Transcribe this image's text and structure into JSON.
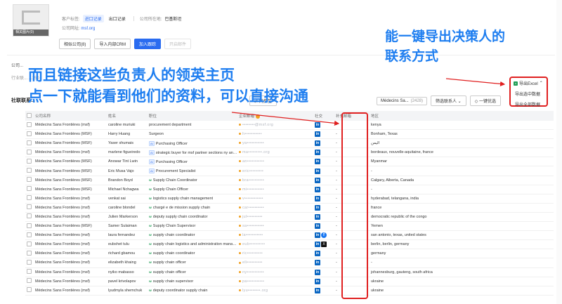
{
  "company": {
    "logo_caption": "相关图片(0)",
    "tag_label": "客户标签:",
    "tag_active": "进口记录",
    "tag_other": "出口记录",
    "country_label": "公司所在地:",
    "country_value": "巴基斯坦",
    "website_label": "公司网址:",
    "website_value": "msf.org"
  },
  "buttons": {
    "similar": "相似公司(8)",
    "import_crm": "导入内部CRM",
    "add_track": "加入跟踪",
    "open_email": "开启邮件"
  },
  "sub_label": "公司...",
  "tabs_hint": "行业联...                  ...150",
  "section_title": "社联联系...",
  "annotations": {
    "top_right_line1": "能一键导出决策人的",
    "top_right_line2": "联系方式",
    "left_line1": "而且链接这些负责人的领英主页",
    "left_line2": "点一下就能看到他们的资料，可以直接沟通"
  },
  "toolbar": {
    "sync_label": "同步至",
    "company_select": "Médecins Sa...",
    "company_count": "(2428)",
    "filter_contact": "筛选联系人",
    "one_key": "一键优选"
  },
  "export": {
    "head": "导出Excel",
    "item1": "导出选中数据",
    "item2": "导出全部数据"
  },
  "table": {
    "headers": [
      "公司名称",
      "姓名",
      "职位",
      "企业邮箱",
      "社交",
      "补充邮箱",
      "地区"
    ],
    "rows": [
      {
        "org": "Médecins Sans Frontières (msf)",
        "name": "caroline muriuki",
        "tag": "",
        "title": "procurement department",
        "email": "••••••••@msf.org",
        "social": [
          "in"
        ],
        "phone": "-",
        "region": "kenya"
      },
      {
        "org": "Médecins Sans Frontières (MSF)",
        "name": "Harry Huang",
        "tag": "",
        "title": "Surgeon",
        "email": "h•••••••••••",
        "social": [
          "in"
        ],
        "phone": "-",
        "region": "Bonham, Texas"
      },
      {
        "org": "Médecins Sans Frontières (MSF)",
        "name": "Yaser shumais",
        "tag": "ai",
        "title": "Purchasing Officer",
        "email": "ya•••••••••••",
        "social": [
          "in"
        ],
        "phone": "-",
        "region": "اليمن"
      },
      {
        "org": "Médecins Sans Frontières (msf)",
        "name": "marlene figueiredo",
        "tag": "ai",
        "title": "strategic buyer for msf partner sections ny and toronto",
        "email": "ma•••••••••.org",
        "social": [
          "in"
        ],
        "phone": "-",
        "region": "bordeaux, nouvelle-aquitaine, france"
      },
      {
        "org": "Médecins Sans Frontières (MSF)",
        "name": "Anowar Tint Lwin",
        "tag": "ai",
        "title": "Purchasing Officer",
        "email": "an•••••••••••",
        "social": [
          "in"
        ],
        "phone": "-",
        "region": "Myanmar"
      },
      {
        "org": "Médecins Sans Frontières (MSF)",
        "name": "Eric Musa Vajo",
        "tag": "ai",
        "title": "Procurement Specialist",
        "email": "eric•••••••••",
        "social": [
          "in"
        ],
        "phone": "-",
        "region": "-"
      },
      {
        "org": "Médecins Sans Frontières (MSF)",
        "name": "Brandon Boyd",
        "tag": "w",
        "title": "Supply Chain Coordinator",
        "email": "bra••••••••••",
        "social": [
          "in"
        ],
        "phone": "-",
        "region": "Calgary, Alberta, Canada"
      },
      {
        "org": "Médecins Sans Frontières (MSF)",
        "name": "Michael Nchagwa",
        "tag": "w",
        "title": "Supply Chain Officer",
        "email": "mi•••••••••••",
        "social": [
          "in"
        ],
        "phone": "-",
        "region": "-"
      },
      {
        "org": "Médecins Sans Frontières (msf)",
        "name": "venkat sai",
        "tag": "w",
        "title": "logistics supply chain management",
        "email": "v••••••••••••",
        "social": [
          "in"
        ],
        "phone": "-",
        "region": "hyderabad, telangana, india"
      },
      {
        "org": "Médecins Sans Frontières (msf)",
        "name": "caroline blondel",
        "tag": "w",
        "title": "chargé e de mission supply chain",
        "email": "car••••••••••",
        "social": [
          "in"
        ],
        "phone": "-",
        "region": "france"
      },
      {
        "org": "Médecins Sans Frontières (msf)",
        "name": "Julien Markerson",
        "tag": "w",
        "title": "deputy supply chain coordinator",
        "email": "jul••••••••••",
        "social": [
          "in"
        ],
        "phone": "-",
        "region": "democratic republic of the congo"
      },
      {
        "org": "Médecins Sans Frontières (MSF)",
        "name": "Samer Sulaiman",
        "tag": "w",
        "title": "Supply Chain Supervisor",
        "email": "sa•••••••••••",
        "social": [
          "in"
        ],
        "phone": "-",
        "region": "Yemen"
      },
      {
        "org": "Médecins Sans Frontières (msf)",
        "name": "laura fernandez",
        "tag": "w",
        "title": "supply chain coordinator",
        "email": "la•••••••••••",
        "social": [
          "in",
          "fb"
        ],
        "phone": "-",
        "region": "san antonio, texas, united states"
      },
      {
        "org": "Médecins Sans Frontières (msf)",
        "name": "eubshet tulu",
        "tag": "w",
        "title": "supply chain logistics and administration manager",
        "email": "eub••••••••••",
        "social": [
          "in",
          "x"
        ],
        "phone": "-",
        "region": "berlin, berlin, germany"
      },
      {
        "org": "Médecins Sans Frontières (msf)",
        "name": "richard gbamou",
        "tag": "w",
        "title": "supply chain coordinator",
        "email": "ric••••••••••",
        "social": [
          "in"
        ],
        "phone": "-",
        "region": "germany"
      },
      {
        "org": "Médecins Sans Frontières (msf)",
        "name": "elizabeth khaing",
        "tag": "w",
        "title": "supply chain officer",
        "email": "eli••••••••••",
        "social": [
          "in"
        ],
        "phone": "-",
        "region": "-"
      },
      {
        "org": "Médecins Sans Frontières (msf)",
        "name": "nyiko mabasso",
        "tag": "w",
        "title": "supply chain officer",
        "email": "ny•••••••••••",
        "social": [
          "in"
        ],
        "phone": "-",
        "region": "johannesburg, gauteng, south africa"
      },
      {
        "org": "Médecins Sans Frontières (msf)",
        "name": "pavel krivolapov",
        "tag": "w",
        "title": "supply chain supervisor",
        "email": "pa•••••••••••",
        "social": [
          "in"
        ],
        "phone": "-",
        "region": "ukraine"
      },
      {
        "org": "Médecins Sans Frontières (msf)",
        "name": "lyudmyla shemchuk",
        "tag": "w",
        "title": "deputy coordinator supply chain",
        "email": "lyu••••••••.org",
        "social": [
          "in"
        ],
        "phone": "-",
        "region": "ukraine"
      }
    ]
  }
}
